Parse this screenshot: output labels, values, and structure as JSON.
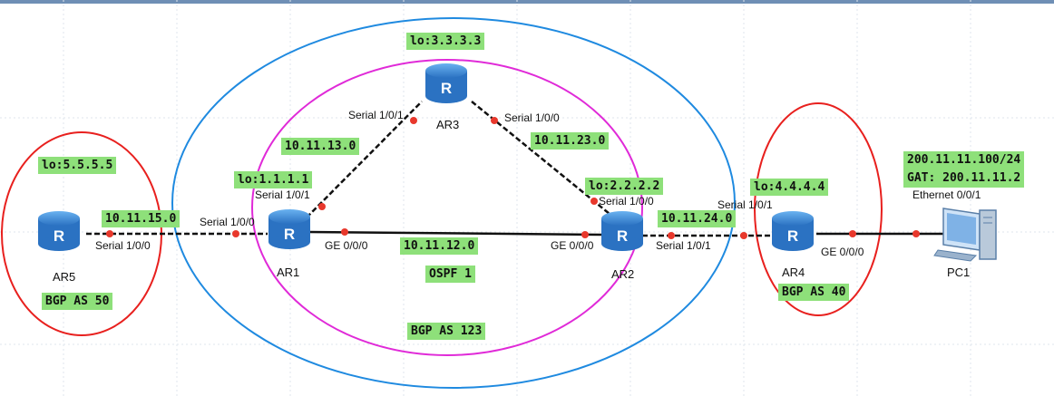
{
  "labels": {
    "lo5": "lo:5.5.5.5",
    "lo1": "lo:1.1.1.1",
    "lo3": "lo:3.3.3.3",
    "lo2": "lo:2.2.2.2",
    "lo4": "lo:4.4.4.4",
    "net15": "10.11.15.0",
    "net13": "10.11.13.0",
    "net23": "10.11.23.0",
    "net12": "10.11.12.0",
    "net24": "10.11.24.0",
    "ospf": "OSPF 1",
    "as50": "BGP AS 50",
    "as123": "BGP AS 123",
    "as40": "BGP AS 40",
    "pc_ip": "200.11.11.100/24",
    "pc_gw": "GAT: 200.11.11.2"
  },
  "ports": {
    "ar5_s000": "Serial 1/0/0",
    "ar1_s000": "Serial 1/0/0",
    "ar1_s001": "Serial 1/0/1",
    "ar1_ge": "GE 0/0/0",
    "ar3_s001": "Serial 1/0/1",
    "ar3_s000": "Serial 1/0/0",
    "ar2_s000": "Serial 1/0/0",
    "ar2_ge": "GE 0/0/0",
    "ar2_s001": "Serial 1/0/1",
    "ar4_s001": "Serial 1/0/1",
    "ar4_ge": "GE 0/0/0",
    "pc_eth": "Ethernet 0/0/1"
  },
  "devices": {
    "ar1": "AR1",
    "ar2": "AR2",
    "ar3": "AR3",
    "ar4": "AR4",
    "ar5": "AR5",
    "pc1": "PC1"
  },
  "colors": {
    "as_ring_red": "#e8201e",
    "as123_ring_blue": "#1f8ae0",
    "ospf_ring_magenta": "#e02ad8",
    "tag_green": "#8ee07a",
    "port_dot": "#e8382c",
    "router_blue": "#3e8ed8"
  },
  "icons": {
    "router": "router-icon",
    "pc": "pc-icon"
  }
}
